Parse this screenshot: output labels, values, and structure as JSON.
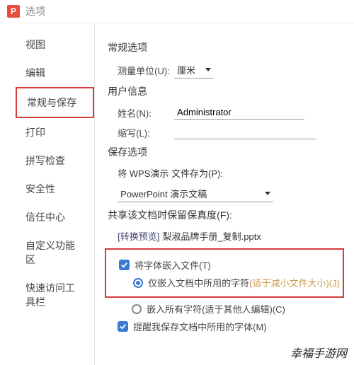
{
  "window": {
    "icon_letter": "P",
    "title": "选项"
  },
  "sidebar": {
    "items": [
      {
        "label": "视图"
      },
      {
        "label": "编辑"
      },
      {
        "label": "常规与保存"
      },
      {
        "label": "打印"
      },
      {
        "label": "拼写检查"
      },
      {
        "label": "安全性"
      },
      {
        "label": "信任中心"
      },
      {
        "label": "自定义功能区"
      },
      {
        "label": "快速访问工具栏"
      }
    ]
  },
  "general": {
    "section": "常规选项",
    "unit_label": "测量单位(U):",
    "unit_value": "厘米"
  },
  "user": {
    "section": "用户信息",
    "name_label": "姓名(N):",
    "name_value": "Administrator",
    "abbr_label": "缩写(L):",
    "abbr_value": ""
  },
  "save": {
    "section": "保存选项",
    "saveas_label": "将 WPS演示 文件存为(P):",
    "saveas_value": "PowerPoint 演示文稿",
    "fidelity_label": "共享该文档时保留保真度(F):",
    "preview_link": "[转换预览]",
    "preview_file": "梨淑品牌手册_复制.pptx",
    "embed_fonts": "将字体嵌入文件(T)",
    "embed_used_only": "仅嵌入文档中所用的字符",
    "embed_used_hint": "(适于减小文件大小)(J)",
    "embed_all": "嵌入所有字符(适于其他人编辑)(C)",
    "warn_fonts": "提醒我保存文档中所用的字体(M)"
  },
  "watermark": "幸福手游网"
}
